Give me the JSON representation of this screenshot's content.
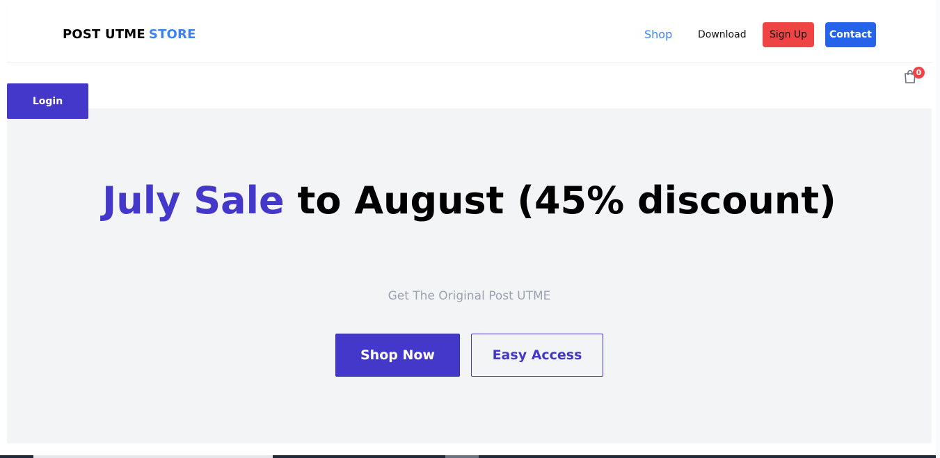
{
  "header": {
    "logo_main": "POST UTME",
    "logo_accent": "STORE",
    "nav": {
      "shop": "Shop",
      "download": "Download",
      "signup": "Sign Up",
      "contact": "Contact"
    }
  },
  "cart": {
    "icon": "shopping-bag-icon",
    "count": "0"
  },
  "login": {
    "label": "Login"
  },
  "hero": {
    "title_highlight": "July Sale",
    "title_rest": "to August (45% discount)",
    "subtitle": "Get The Original Post UTME",
    "primary_button": "Shop Now",
    "secondary_button": "Easy Access"
  },
  "colors": {
    "brand_blue": "#3b82f6",
    "indigo": "#4338ca",
    "signup_red": "#ef4444",
    "contact_blue": "#2563eb",
    "hero_bg": "#f3f4f6"
  }
}
